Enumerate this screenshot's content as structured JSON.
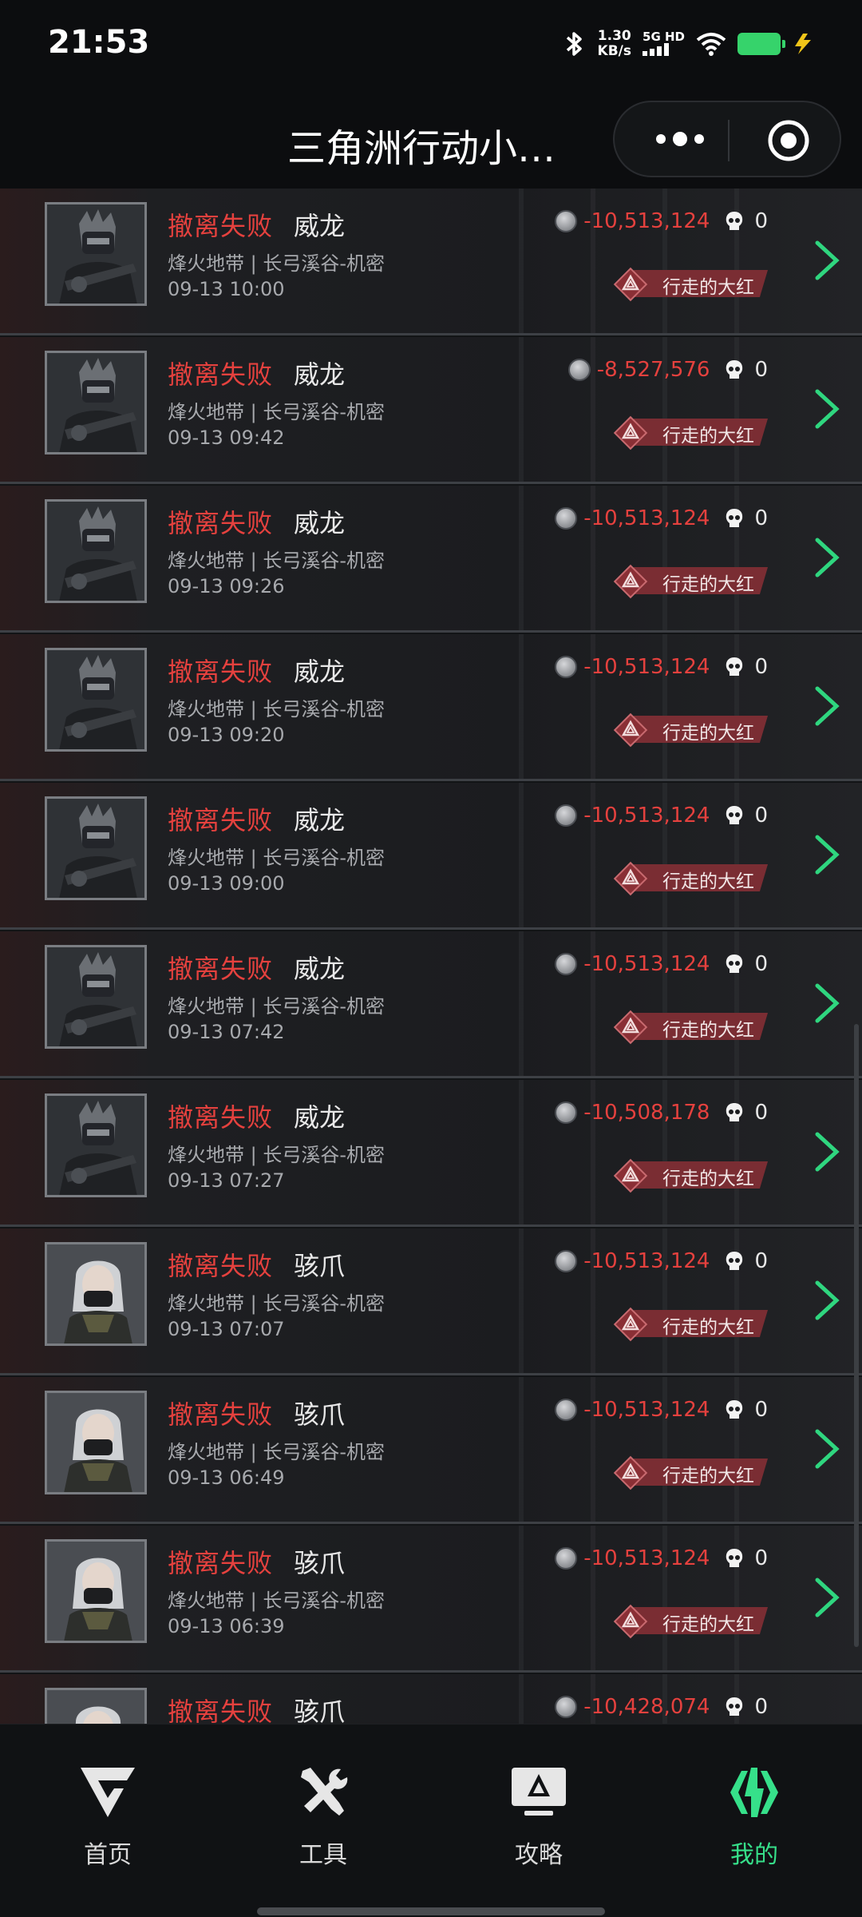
{
  "status_bar": {
    "time": "21:53",
    "net_speed_value": "1.30",
    "net_speed_unit": "KB/s",
    "net_type": "5G HD"
  },
  "header": {
    "title": "三角洲行动小…"
  },
  "colors": {
    "accent_green": "#36e08a",
    "fail_red": "#e5413e",
    "badge_red": "#7a2d33"
  },
  "records": [
    {
      "status": "撤离失败",
      "operator": "威龙",
      "map": "烽火地带 | 长弓溪谷-机密",
      "time": "09-13 10:00",
      "value": "-10,513,124",
      "kills": "0",
      "rank": "行走的大红",
      "avatar": "weilong"
    },
    {
      "status": "撤离失败",
      "operator": "威龙",
      "map": "烽火地带 | 长弓溪谷-机密",
      "time": "09-13 09:42",
      "value": "-8,527,576",
      "kills": "0",
      "rank": "行走的大红",
      "avatar": "weilong"
    },
    {
      "status": "撤离失败",
      "operator": "威龙",
      "map": "烽火地带 | 长弓溪谷-机密",
      "time": "09-13 09:26",
      "value": "-10,513,124",
      "kills": "0",
      "rank": "行走的大红",
      "avatar": "weilong"
    },
    {
      "status": "撤离失败",
      "operator": "威龙",
      "map": "烽火地带 | 长弓溪谷-机密",
      "time": "09-13 09:20",
      "value": "-10,513,124",
      "kills": "0",
      "rank": "行走的大红",
      "avatar": "weilong"
    },
    {
      "status": "撤离失败",
      "operator": "威龙",
      "map": "烽火地带 | 长弓溪谷-机密",
      "time": "09-13 09:00",
      "value": "-10,513,124",
      "kills": "0",
      "rank": "行走的大红",
      "avatar": "weilong"
    },
    {
      "status": "撤离失败",
      "operator": "威龙",
      "map": "烽火地带 | 长弓溪谷-机密",
      "time": "09-13 07:42",
      "value": "-10,513,124",
      "kills": "0",
      "rank": "行走的大红",
      "avatar": "weilong"
    },
    {
      "status": "撤离失败",
      "operator": "威龙",
      "map": "烽火地带 | 长弓溪谷-机密",
      "time": "09-13 07:27",
      "value": "-10,508,178",
      "kills": "0",
      "rank": "行走的大红",
      "avatar": "weilong"
    },
    {
      "status": "撤离失败",
      "operator": "骇爪",
      "map": "烽火地带 | 长弓溪谷-机密",
      "time": "09-13 07:07",
      "value": "-10,513,124",
      "kills": "0",
      "rank": "行走的大红",
      "avatar": "haizhua"
    },
    {
      "status": "撤离失败",
      "operator": "骇爪",
      "map": "烽火地带 | 长弓溪谷-机密",
      "time": "09-13 06:49",
      "value": "-10,513,124",
      "kills": "0",
      "rank": "行走的大红",
      "avatar": "haizhua"
    },
    {
      "status": "撤离失败",
      "operator": "骇爪",
      "map": "烽火地带 | 长弓溪谷-机密",
      "time": "09-13 06:39",
      "value": "-10,513,124",
      "kills": "0",
      "rank": "行走的大红",
      "avatar": "haizhua"
    },
    {
      "status": "撤离失败",
      "operator": "骇爪",
      "map": "",
      "time": "",
      "value": "-10,428,074",
      "kills": "0",
      "rank": "",
      "avatar": "haizhua"
    }
  ],
  "tabs": [
    {
      "label": "首页",
      "icon": "home-logo-icon",
      "active": false
    },
    {
      "label": "工具",
      "icon": "tools-icon",
      "active": false
    },
    {
      "label": "攻略",
      "icon": "guide-monitor-icon",
      "active": false
    },
    {
      "label": "我的",
      "icon": "profile-logo-icon",
      "active": true
    }
  ]
}
